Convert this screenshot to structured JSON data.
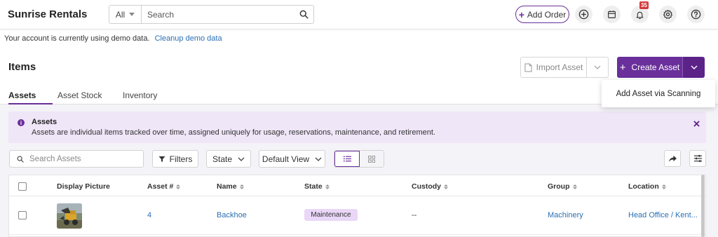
{
  "header": {
    "brand": "Sunrise Rentals",
    "search_scope": "All",
    "search_placeholder": "Search",
    "add_order_label": "Add Order",
    "notification_count": "35",
    "icons": [
      "add-circle-icon",
      "calendar-icon",
      "bell-icon",
      "gear-icon",
      "help-icon"
    ]
  },
  "demo_notice": {
    "text": "Your account is currently using demo data.",
    "link": "Cleanup demo data"
  },
  "page": {
    "title": "Items",
    "import_label": "Import Asset",
    "create_label": "Create Asset",
    "dropdown_item": "Add Asset via Scanning"
  },
  "tabs": [
    {
      "label": "Assets",
      "active": true
    },
    {
      "label": "Asset Stock",
      "active": false
    },
    {
      "label": "Inventory",
      "active": false
    }
  ],
  "info": {
    "title": "Assets",
    "description": "Assets are individual items tracked over time, assigned uniquely for usage, reservations, maintenance, and retirement."
  },
  "toolbar": {
    "search_placeholder": "Search Assets",
    "filters_label": "Filters",
    "state_label": "State",
    "view_label": "Default View"
  },
  "table": {
    "columns": [
      "Display Picture",
      "Asset #",
      "Name",
      "State",
      "Custody",
      "Group",
      "Location"
    ],
    "rows": [
      {
        "asset_no": "4",
        "name": "Backhoe",
        "state": "Maintenance",
        "custody": "--",
        "group": "Machinery",
        "location": "Head Office / Kent..."
      }
    ]
  },
  "colors": {
    "accent": "#6a2f9b",
    "link": "#2b6fb3",
    "info_bg": "#efe6f8",
    "pill_bg": "#ead7f7",
    "badge": "#d23a3a"
  }
}
